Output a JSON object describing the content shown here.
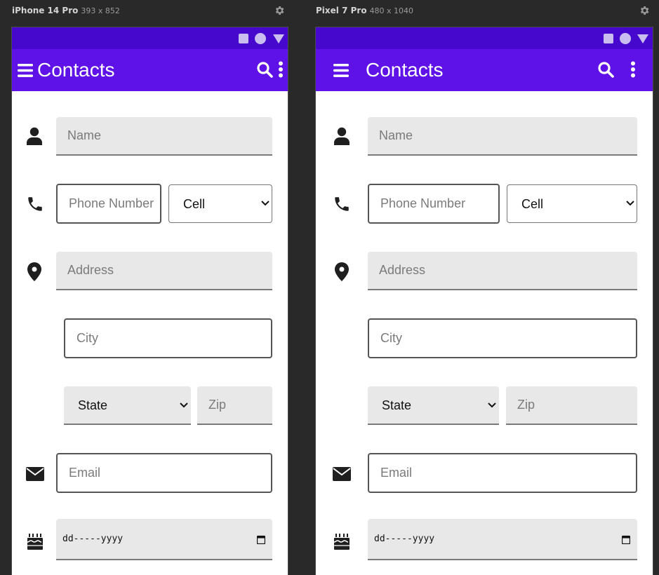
{
  "devices": [
    {
      "name": "iPhone 14 Pro",
      "dims": "393 x 852"
    },
    {
      "name": "Pixel 7 Pro",
      "dims": "480 x 1040"
    }
  ],
  "app": {
    "title": "Contacts"
  },
  "form": {
    "name_placeholder": "Name",
    "phone_placeholder": "Phone Number",
    "phone_type": "Cell",
    "phone_type_options": [
      "Cell"
    ],
    "address_placeholder": "Address",
    "city_placeholder": "City",
    "state_value": "State",
    "state_options": [
      "State"
    ],
    "zip_placeholder": "Zip",
    "email_placeholder": "Email",
    "birthday_placeholder": "dd-----yyyy"
  },
  "colors": {
    "app_bar": "#5e12e8",
    "status_bar": "#4608cc",
    "field_fill": "#e8e8e8",
    "background": "#292929"
  },
  "icons": [
    "menu-icon",
    "search-icon",
    "more-vert-icon",
    "person-icon",
    "phone-icon",
    "location-icon",
    "email-icon",
    "cake-icon",
    "calendar-icon",
    "gear-icon"
  ]
}
